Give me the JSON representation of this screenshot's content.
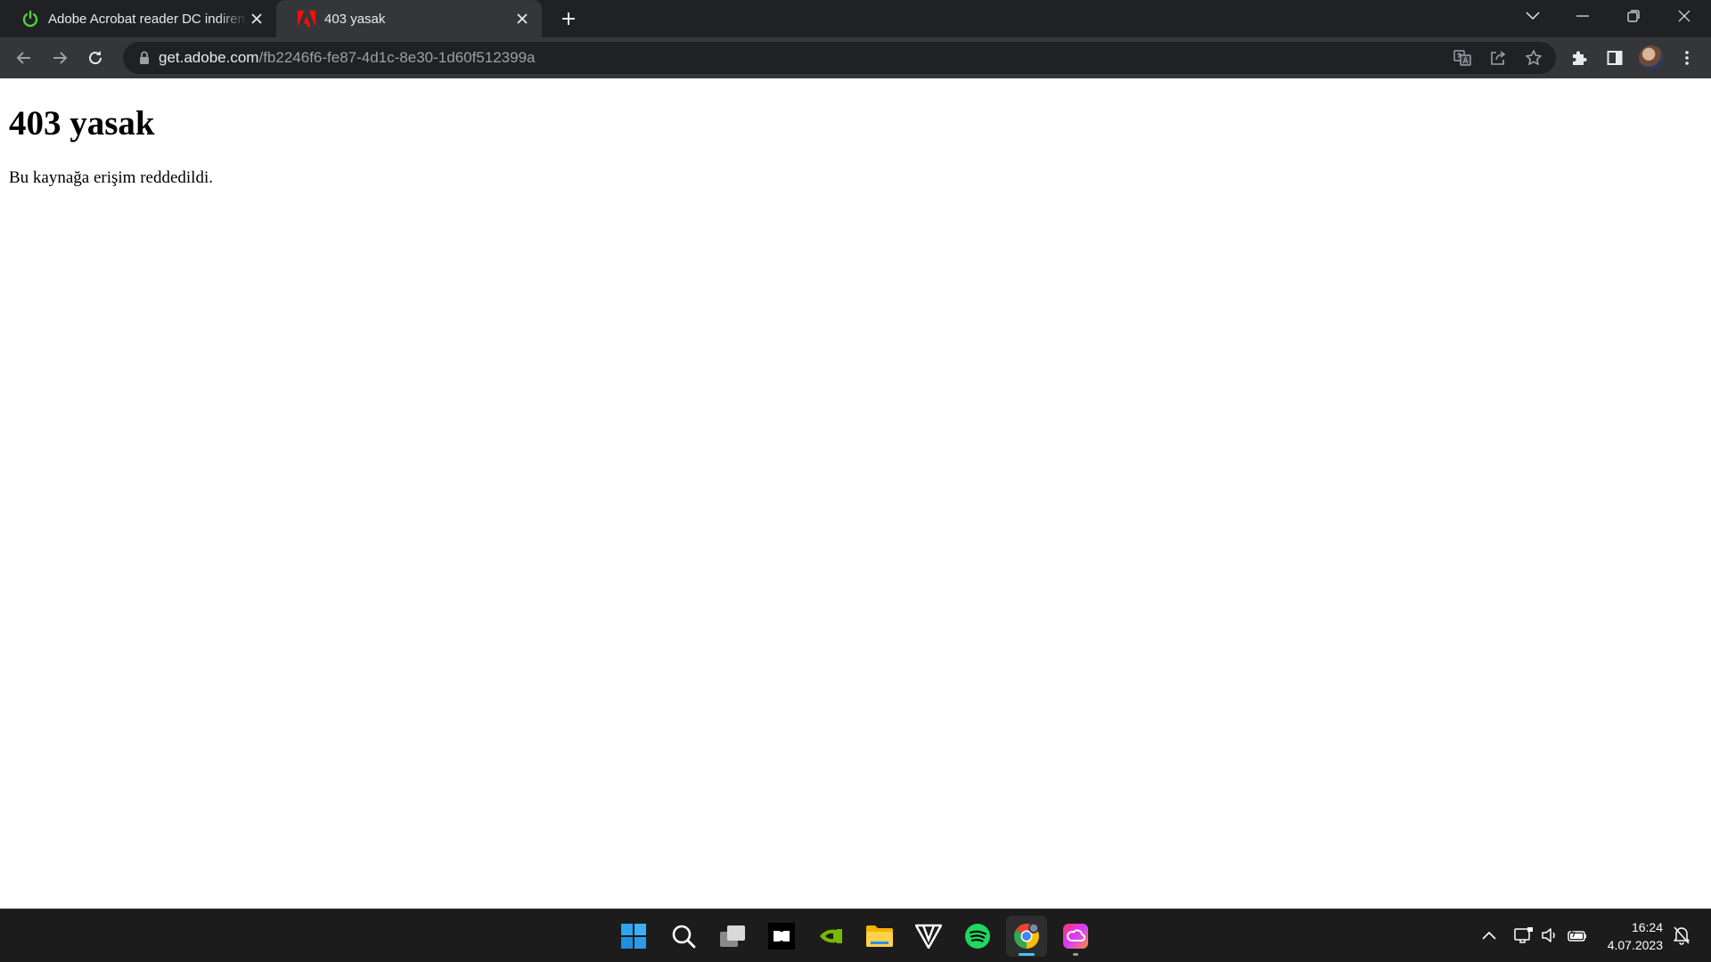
{
  "tabs": [
    {
      "title": "Adobe Acrobat reader DC indiren",
      "icon": "power-icon",
      "active": false
    },
    {
      "title": "403 yasak",
      "icon": "adobe-icon",
      "active": true
    }
  ],
  "omnibox": {
    "url_host": "get.adobe.com",
    "url_path": "/fb2246f6-fe87-4d1c-8e30-1d60f512399a"
  },
  "page": {
    "heading": "403 yasak",
    "message": "Bu kaynağa erişim reddedildi."
  },
  "taskbar": {
    "apps": [
      "windows-start",
      "search",
      "task-view",
      "dolby-access",
      "nvidia",
      "file-explorer",
      "vectorworks",
      "spotify",
      "chrome",
      "creative-cloud"
    ],
    "clock_time": "16:24",
    "clock_date": "4.07.2023"
  },
  "colors": {
    "tabstrip_bg": "#202124",
    "toolbar_bg": "#35363a",
    "omnibox_bg": "#202124",
    "taskbar_bg": "#1c1c1c",
    "adobe_red": "#fa0f00",
    "power_green": "#4cd137",
    "spotify_green": "#1ed760",
    "nvidia_green": "#76b900"
  }
}
